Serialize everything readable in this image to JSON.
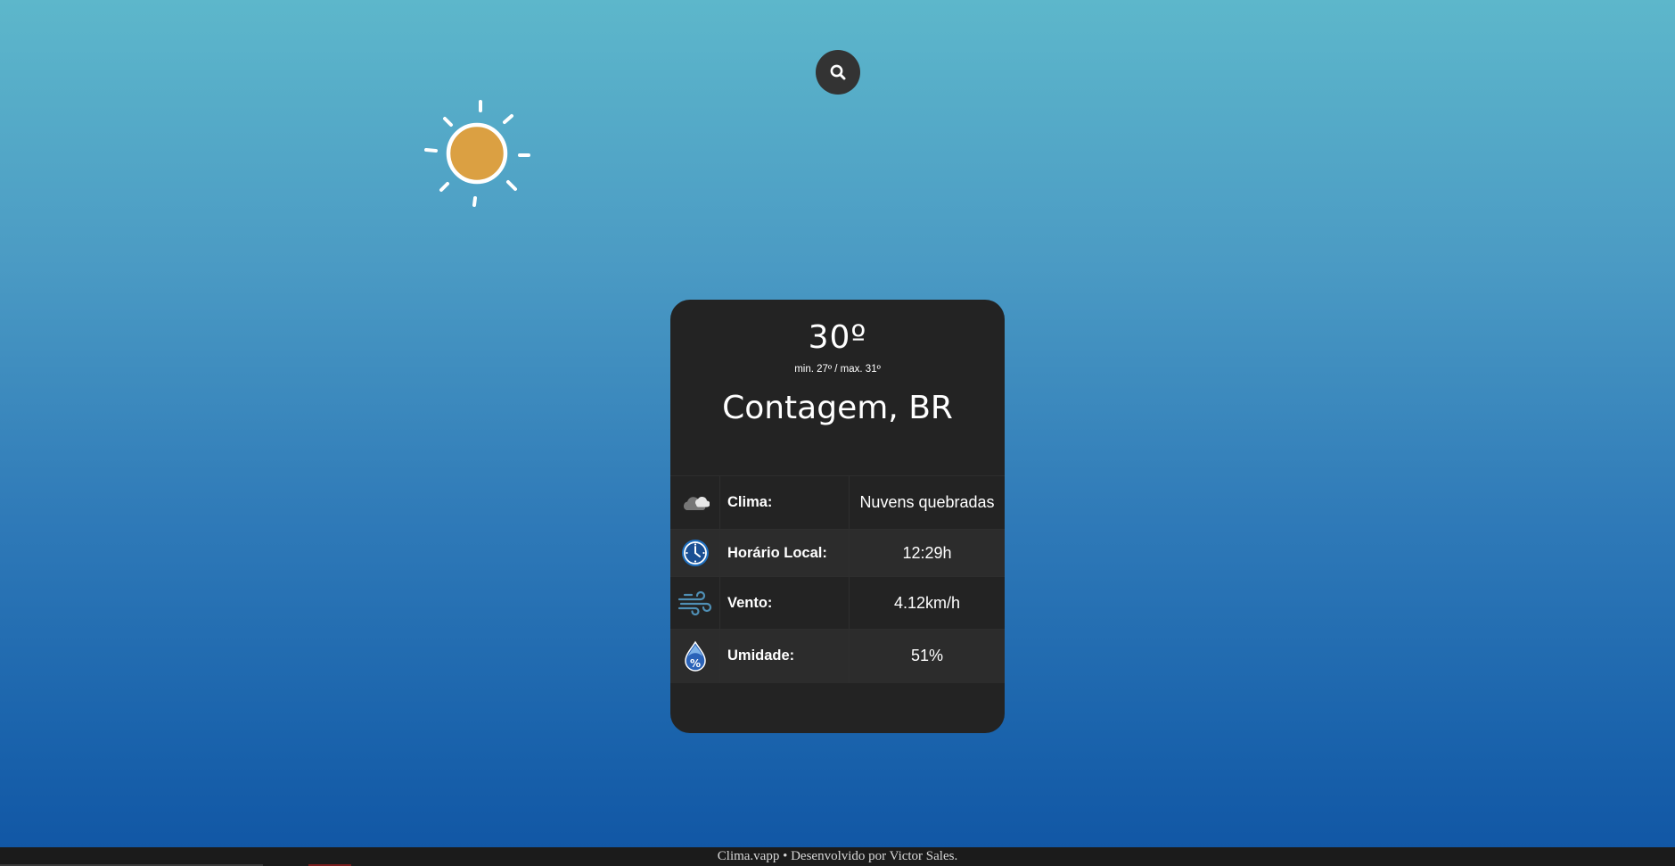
{
  "app": {
    "name": "Clima.vapp"
  },
  "icons": {
    "search": "search-icon",
    "sun": "sun-icon",
    "weather": "cloud-icon",
    "time": "clock-icon",
    "wind": "wind-icon",
    "humidity": "humidity-drop-icon"
  },
  "weather": {
    "temperature": "30º",
    "minmax": "min. 27º / max. 31º",
    "city": "Contagem, BR"
  },
  "details": [
    {
      "label": "Clima:",
      "value": "Nuvens quebradas"
    },
    {
      "label": "Horário Local:",
      "value": "12:29h"
    },
    {
      "label": "Vento:",
      "value": "4.12km/h"
    },
    {
      "label": "Umidade:",
      "value": "51%"
    }
  ],
  "footer": {
    "text": "Clima.vapp • Desenvolvido por Victor Sales."
  },
  "colors": {
    "background_top": "#5db7cb",
    "background_bottom": "#1055a4",
    "card": "#232323",
    "sun": "#dba042",
    "search_button": "#333333"
  }
}
